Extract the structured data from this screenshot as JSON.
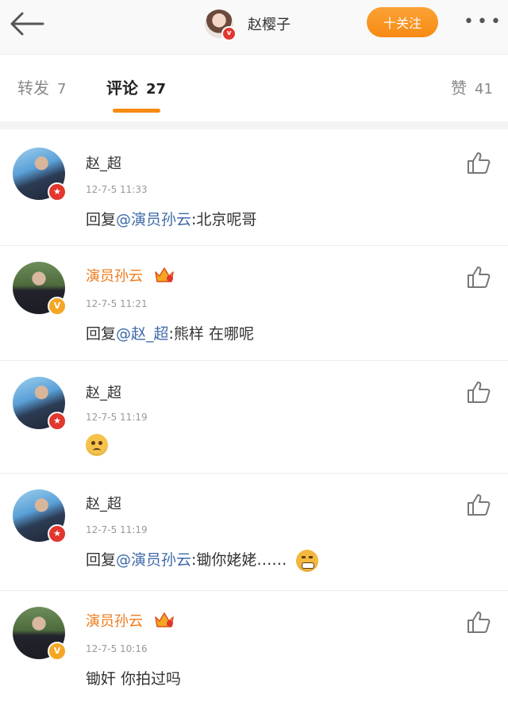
{
  "header": {
    "title": "赵樱子",
    "follow_label": "十关注",
    "more_label": "•••"
  },
  "tabs": [
    {
      "label": "转发",
      "count": "7"
    },
    {
      "label": "评论",
      "count": "27"
    },
    {
      "label": "赞",
      "count": "41"
    }
  ],
  "comments": [
    {
      "name": "赵_超",
      "time": "12-7-5 11:33",
      "prefix": "回复",
      "mention": "@演员孙云",
      "text": ":北京呢哥"
    },
    {
      "name": "演员孙云",
      "time": "12-7-5 11:21",
      "prefix": "回复",
      "mention": "@赵_超",
      "text": ":熊样 在哪呢"
    },
    {
      "name": "赵_超",
      "time": "12-7-5 11:19"
    },
    {
      "name": "赵_超",
      "time": "12-7-5 11:19",
      "prefix": "回复",
      "mention": "@演员孙云",
      "text": ":锄你姥姥……"
    },
    {
      "name": "演员孙云",
      "time": "12-7-5 10:16",
      "text": "锄奸 你拍过吗"
    }
  ],
  "colors": {
    "accent": "#f78a12",
    "mention": "#3e6aa8",
    "vip_name": "#f07b1a"
  },
  "icons": [
    "back-arrow-icon",
    "verified-badge-icon",
    "thumb-up-icon",
    "crown-vip-icon",
    "emoji-sad-icon",
    "emoji-grimace-icon"
  ]
}
